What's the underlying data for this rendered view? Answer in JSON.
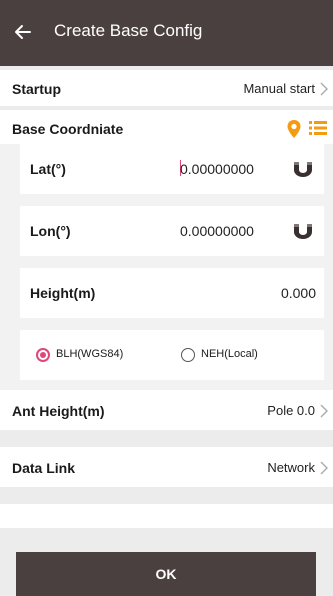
{
  "header": {
    "title": "Create Base Config"
  },
  "startup": {
    "label": "Startup",
    "value": "Manual start"
  },
  "base_coordinate": {
    "label": "Base Coordniate",
    "lat": {
      "label": "Lat(°)",
      "value": "0.00000000"
    },
    "lon": {
      "label": "Lon(°)",
      "value": "0.00000000"
    },
    "height": {
      "label": "Height(m)",
      "value": "0.000"
    },
    "options": [
      {
        "label": "BLH(WGS84)",
        "selected": true
      },
      {
        "label": "NEH(Local)",
        "selected": false
      }
    ]
  },
  "ant_height": {
    "label": "Ant Height(m)",
    "value": "Pole 0.0"
  },
  "data_link": {
    "label": "Data Link",
    "value": "Network"
  },
  "ok_button": {
    "label": "OK"
  },
  "colors": {
    "titlebar": "#4a403f",
    "accent_orange": "#f39c12",
    "radio_pink": "#e0457b"
  },
  "icons": [
    "back-arrow-icon",
    "location-pin-icon",
    "list-icon",
    "magnet-icon",
    "chevron-right-icon"
  ]
}
